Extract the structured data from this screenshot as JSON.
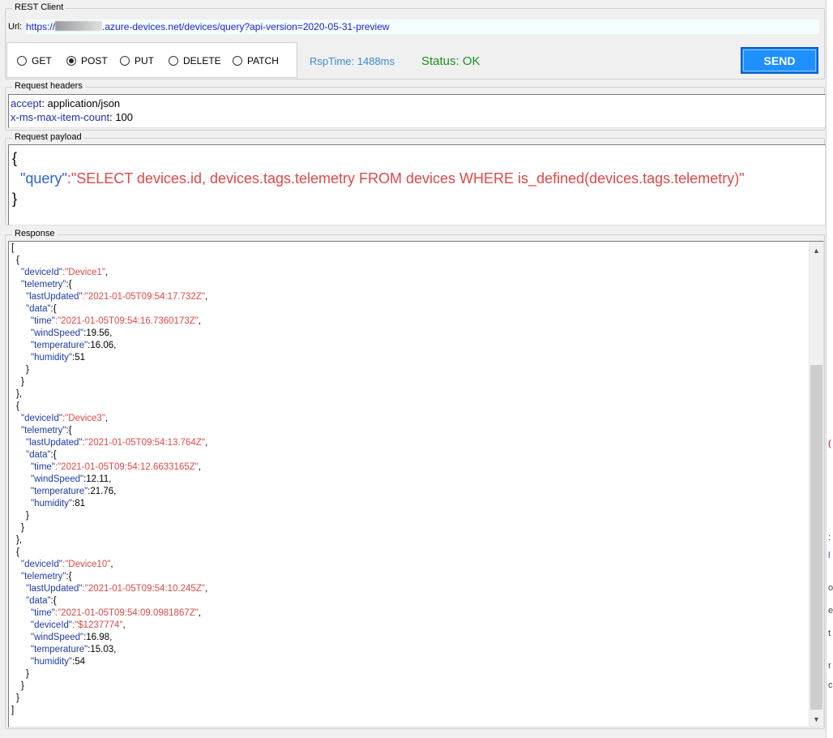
{
  "window": {
    "title": "REST Client"
  },
  "url": {
    "label": "Url:",
    "prefix": "https://",
    "suffix": ".azure-devices.net/devices/query?api-version=2020-05-31-preview"
  },
  "methods": [
    {
      "label": "GET",
      "selected": false
    },
    {
      "label": "POST",
      "selected": true
    },
    {
      "label": "PUT",
      "selected": false
    },
    {
      "label": "DELETE",
      "selected": false
    },
    {
      "label": "PATCH",
      "selected": false
    }
  ],
  "rsp_time": "RspTime: 1488ms",
  "status": "Status: OK",
  "send_label": "SEND",
  "request_headers": {
    "title": "Request headers",
    "lines": [
      {
        "key": "accept",
        "value": " application/json"
      },
      {
        "key": "x-ms-max-item-count",
        "value": " 100"
      }
    ]
  },
  "request_payload": {
    "title": "Request payload",
    "open": "{",
    "key": "\"query\"",
    "colon": ":",
    "value": "\"SELECT devices.id, devices.tags.telemetry FROM devices WHERE is_defined(devices.tags.telemetry)\"",
    "close": "}"
  },
  "response": {
    "title": "Response",
    "lines": [
      {
        "indent": 0,
        "pre": "[",
        "key": "",
        "str": "",
        "num": "",
        "post": ""
      },
      {
        "indent": 1,
        "pre": "{",
        "key": "",
        "str": "",
        "num": "",
        "post": ""
      },
      {
        "indent": 2,
        "pre": "",
        "key": "\"deviceId\"",
        "str": ":\"Device1\"",
        "num": "",
        "post": ","
      },
      {
        "indent": 2,
        "pre": "",
        "key": "\"telemetry\"",
        "str": "",
        "num": "",
        "post": ":{"
      },
      {
        "indent": 3,
        "pre": "",
        "key": "\"lastUpdated\"",
        "str": ":\"2021-01-05T09:54:17.732Z\"",
        "num": "",
        "post": ","
      },
      {
        "indent": 3,
        "pre": "",
        "key": "\"data\"",
        "str": "",
        "num": "",
        "post": ":{"
      },
      {
        "indent": 4,
        "pre": "",
        "key": "\"time\"",
        "str": ":\"2021-01-05T09:54:16.7360173Z\"",
        "num": "",
        "post": ","
      },
      {
        "indent": 4,
        "pre": "",
        "key": "\"windSpeed\"",
        "str": "",
        "num": ":19.56",
        "post": ","
      },
      {
        "indent": 4,
        "pre": "",
        "key": "\"temperature\"",
        "str": "",
        "num": ":16.06",
        "post": ","
      },
      {
        "indent": 4,
        "pre": "",
        "key": "\"humidity\"",
        "str": "",
        "num": ":51",
        "post": ""
      },
      {
        "indent": 3,
        "pre": "}",
        "key": "",
        "str": "",
        "num": "",
        "post": ""
      },
      {
        "indent": 2,
        "pre": "}",
        "key": "",
        "str": "",
        "num": "",
        "post": ""
      },
      {
        "indent": 1,
        "pre": "},",
        "key": "",
        "str": "",
        "num": "",
        "post": ""
      },
      {
        "indent": 1,
        "pre": "{",
        "key": "",
        "str": "",
        "num": "",
        "post": ""
      },
      {
        "indent": 2,
        "pre": "",
        "key": "\"deviceId\"",
        "str": ":\"Device3\"",
        "num": "",
        "post": ","
      },
      {
        "indent": 2,
        "pre": "",
        "key": "\"telemetry\"",
        "str": "",
        "num": "",
        "post": ":{"
      },
      {
        "indent": 3,
        "pre": "",
        "key": "\"lastUpdated\"",
        "str": ":\"2021-01-05T09:54:13.764Z\"",
        "num": "",
        "post": ","
      },
      {
        "indent": 3,
        "pre": "",
        "key": "\"data\"",
        "str": "",
        "num": "",
        "post": ":{"
      },
      {
        "indent": 4,
        "pre": "",
        "key": "\"time\"",
        "str": ":\"2021-01-05T09:54:12.6633165Z\"",
        "num": "",
        "post": ","
      },
      {
        "indent": 4,
        "pre": "",
        "key": "\"windSpeed\"",
        "str": "",
        "num": ":12.11",
        "post": ","
      },
      {
        "indent": 4,
        "pre": "",
        "key": "\"temperature\"",
        "str": "",
        "num": ":21.76",
        "post": ","
      },
      {
        "indent": 4,
        "pre": "",
        "key": "\"humidity\"",
        "str": "",
        "num": ":81",
        "post": ""
      },
      {
        "indent": 3,
        "pre": "}",
        "key": "",
        "str": "",
        "num": "",
        "post": ""
      },
      {
        "indent": 2,
        "pre": "}",
        "key": "",
        "str": "",
        "num": "",
        "post": ""
      },
      {
        "indent": 1,
        "pre": "},",
        "key": "",
        "str": "",
        "num": "",
        "post": ""
      },
      {
        "indent": 1,
        "pre": "{",
        "key": "",
        "str": "",
        "num": "",
        "post": ""
      },
      {
        "indent": 2,
        "pre": "",
        "key": "\"deviceId\"",
        "str": ":\"Device10\"",
        "num": "",
        "post": ","
      },
      {
        "indent": 2,
        "pre": "",
        "key": "\"telemetry\"",
        "str": "",
        "num": "",
        "post": ":{"
      },
      {
        "indent": 3,
        "pre": "",
        "key": "\"lastUpdated\"",
        "str": ":\"2021-01-05T09:54:10.245Z\"",
        "num": "",
        "post": ","
      },
      {
        "indent": 3,
        "pre": "",
        "key": "\"data\"",
        "str": "",
        "num": "",
        "post": ":{"
      },
      {
        "indent": 4,
        "pre": "",
        "key": "\"time\"",
        "str": ":\"2021-01-05T09:54:09.0981867Z\"",
        "num": "",
        "post": ","
      },
      {
        "indent": 4,
        "pre": "",
        "key": "\"deviceId\"",
        "str": ":\"$1237774\"",
        "num": "",
        "post": ","
      },
      {
        "indent": 4,
        "pre": "",
        "key": "\"windSpeed\"",
        "str": "",
        "num": ":16.98",
        "post": ","
      },
      {
        "indent": 4,
        "pre": "",
        "key": "\"temperature\"",
        "str": "",
        "num": ":15.03",
        "post": ","
      },
      {
        "indent": 4,
        "pre": "",
        "key": "\"humidity\"",
        "str": "",
        "num": ":54",
        "post": ""
      },
      {
        "indent": 3,
        "pre": "}",
        "key": "",
        "str": "",
        "num": "",
        "post": ""
      },
      {
        "indent": 2,
        "pre": "}",
        "key": "",
        "str": "",
        "num": "",
        "post": ""
      },
      {
        "indent": 1,
        "pre": "}",
        "key": "",
        "str": "",
        "num": "",
        "post": ""
      },
      {
        "indent": 0,
        "pre": "]",
        "key": "",
        "str": "",
        "num": "",
        "post": ""
      }
    ]
  },
  "scrollbar": {
    "up_icon": "scroll-up-arrow-icon",
    "down_icon": "scroll-down-arrow-icon"
  },
  "colors": {
    "url_text": "#1f1fd0",
    "json_key": "#1f3aa8",
    "json_string": "#e04848",
    "status_ok": "#1d8f1d",
    "rsp_time": "#3c8bcf",
    "send_button": "#1e90ff"
  }
}
